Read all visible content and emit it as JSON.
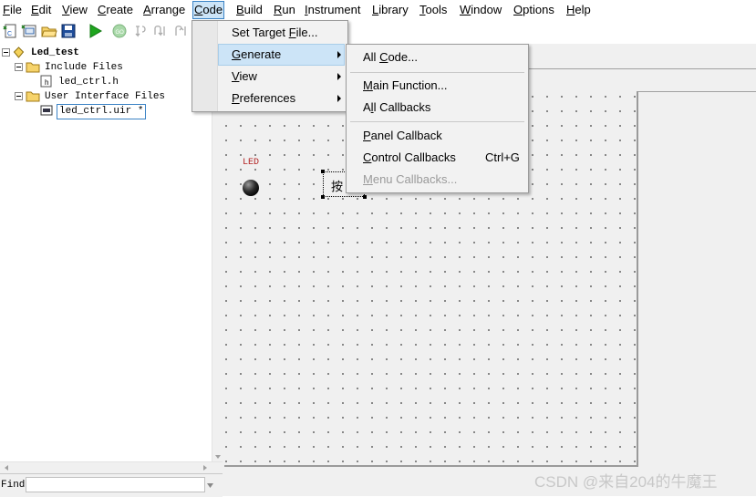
{
  "menubar": {
    "items": [
      "File",
      "Edit",
      "View",
      "Create",
      "Arrange",
      "Code",
      "Build",
      "Run",
      "Instrument",
      "Library",
      "Tools",
      "Window",
      "Options",
      "Help"
    ],
    "mnemonics": [
      "F",
      "E",
      "V",
      "C",
      "A",
      "C",
      "B",
      "R",
      "I",
      "L",
      "T",
      "W",
      "O",
      "H"
    ],
    "active": "Code"
  },
  "tree": {
    "project": "Led_test",
    "include_folder": "Include Files",
    "include_file": "led_ctrl.h",
    "ui_folder": "User Interface Files",
    "ui_file": "led_ctrl.uir *"
  },
  "find": {
    "label": "Find",
    "value": ""
  },
  "panel": {
    "led_label": "LED",
    "button_label": "按"
  },
  "code_menu": {
    "items": [
      {
        "label": "Set Target File...",
        "underline": "F",
        "submenu": false
      },
      {
        "label": "Generate",
        "underline": "G",
        "submenu": true,
        "highlighted": true
      },
      {
        "label": "View",
        "underline": "V",
        "submenu": true
      },
      {
        "label": "Preferences",
        "underline": "P",
        "submenu": true
      }
    ]
  },
  "generate_menu": {
    "items": [
      {
        "label": "All Code...",
        "underline": "C",
        "shortcut": "",
        "disabled": false
      },
      {
        "label": "Main Function...",
        "underline": "M",
        "shortcut": "",
        "disabled": false
      },
      {
        "label": "All Callbacks",
        "underline": "l",
        "shortcut": "",
        "disabled": false
      },
      {
        "label": "Panel Callback",
        "underline": "P",
        "shortcut": "",
        "disabled": false
      },
      {
        "label": "Control Callbacks",
        "underline": "C",
        "shortcut": "Ctrl+G",
        "disabled": false
      },
      {
        "label": "Menu Callbacks...",
        "underline": "M",
        "shortcut": "",
        "disabled": true
      }
    ]
  },
  "icons": [
    "new-file-icon",
    "new-uir-icon",
    "open-folder-icon",
    "save-icon",
    "run-icon",
    "go-icon",
    "step-into-icon",
    "step-over-icon",
    "step-out-icon"
  ],
  "colors": {
    "highlight": "#cce4f7",
    "highlight_border": "#3b83c5",
    "run_green": "#1fa51f",
    "led_label": "#b22222",
    "disabled_text": "#9a9a9a"
  },
  "watermark": "CSDN @来自204的牛魔王"
}
